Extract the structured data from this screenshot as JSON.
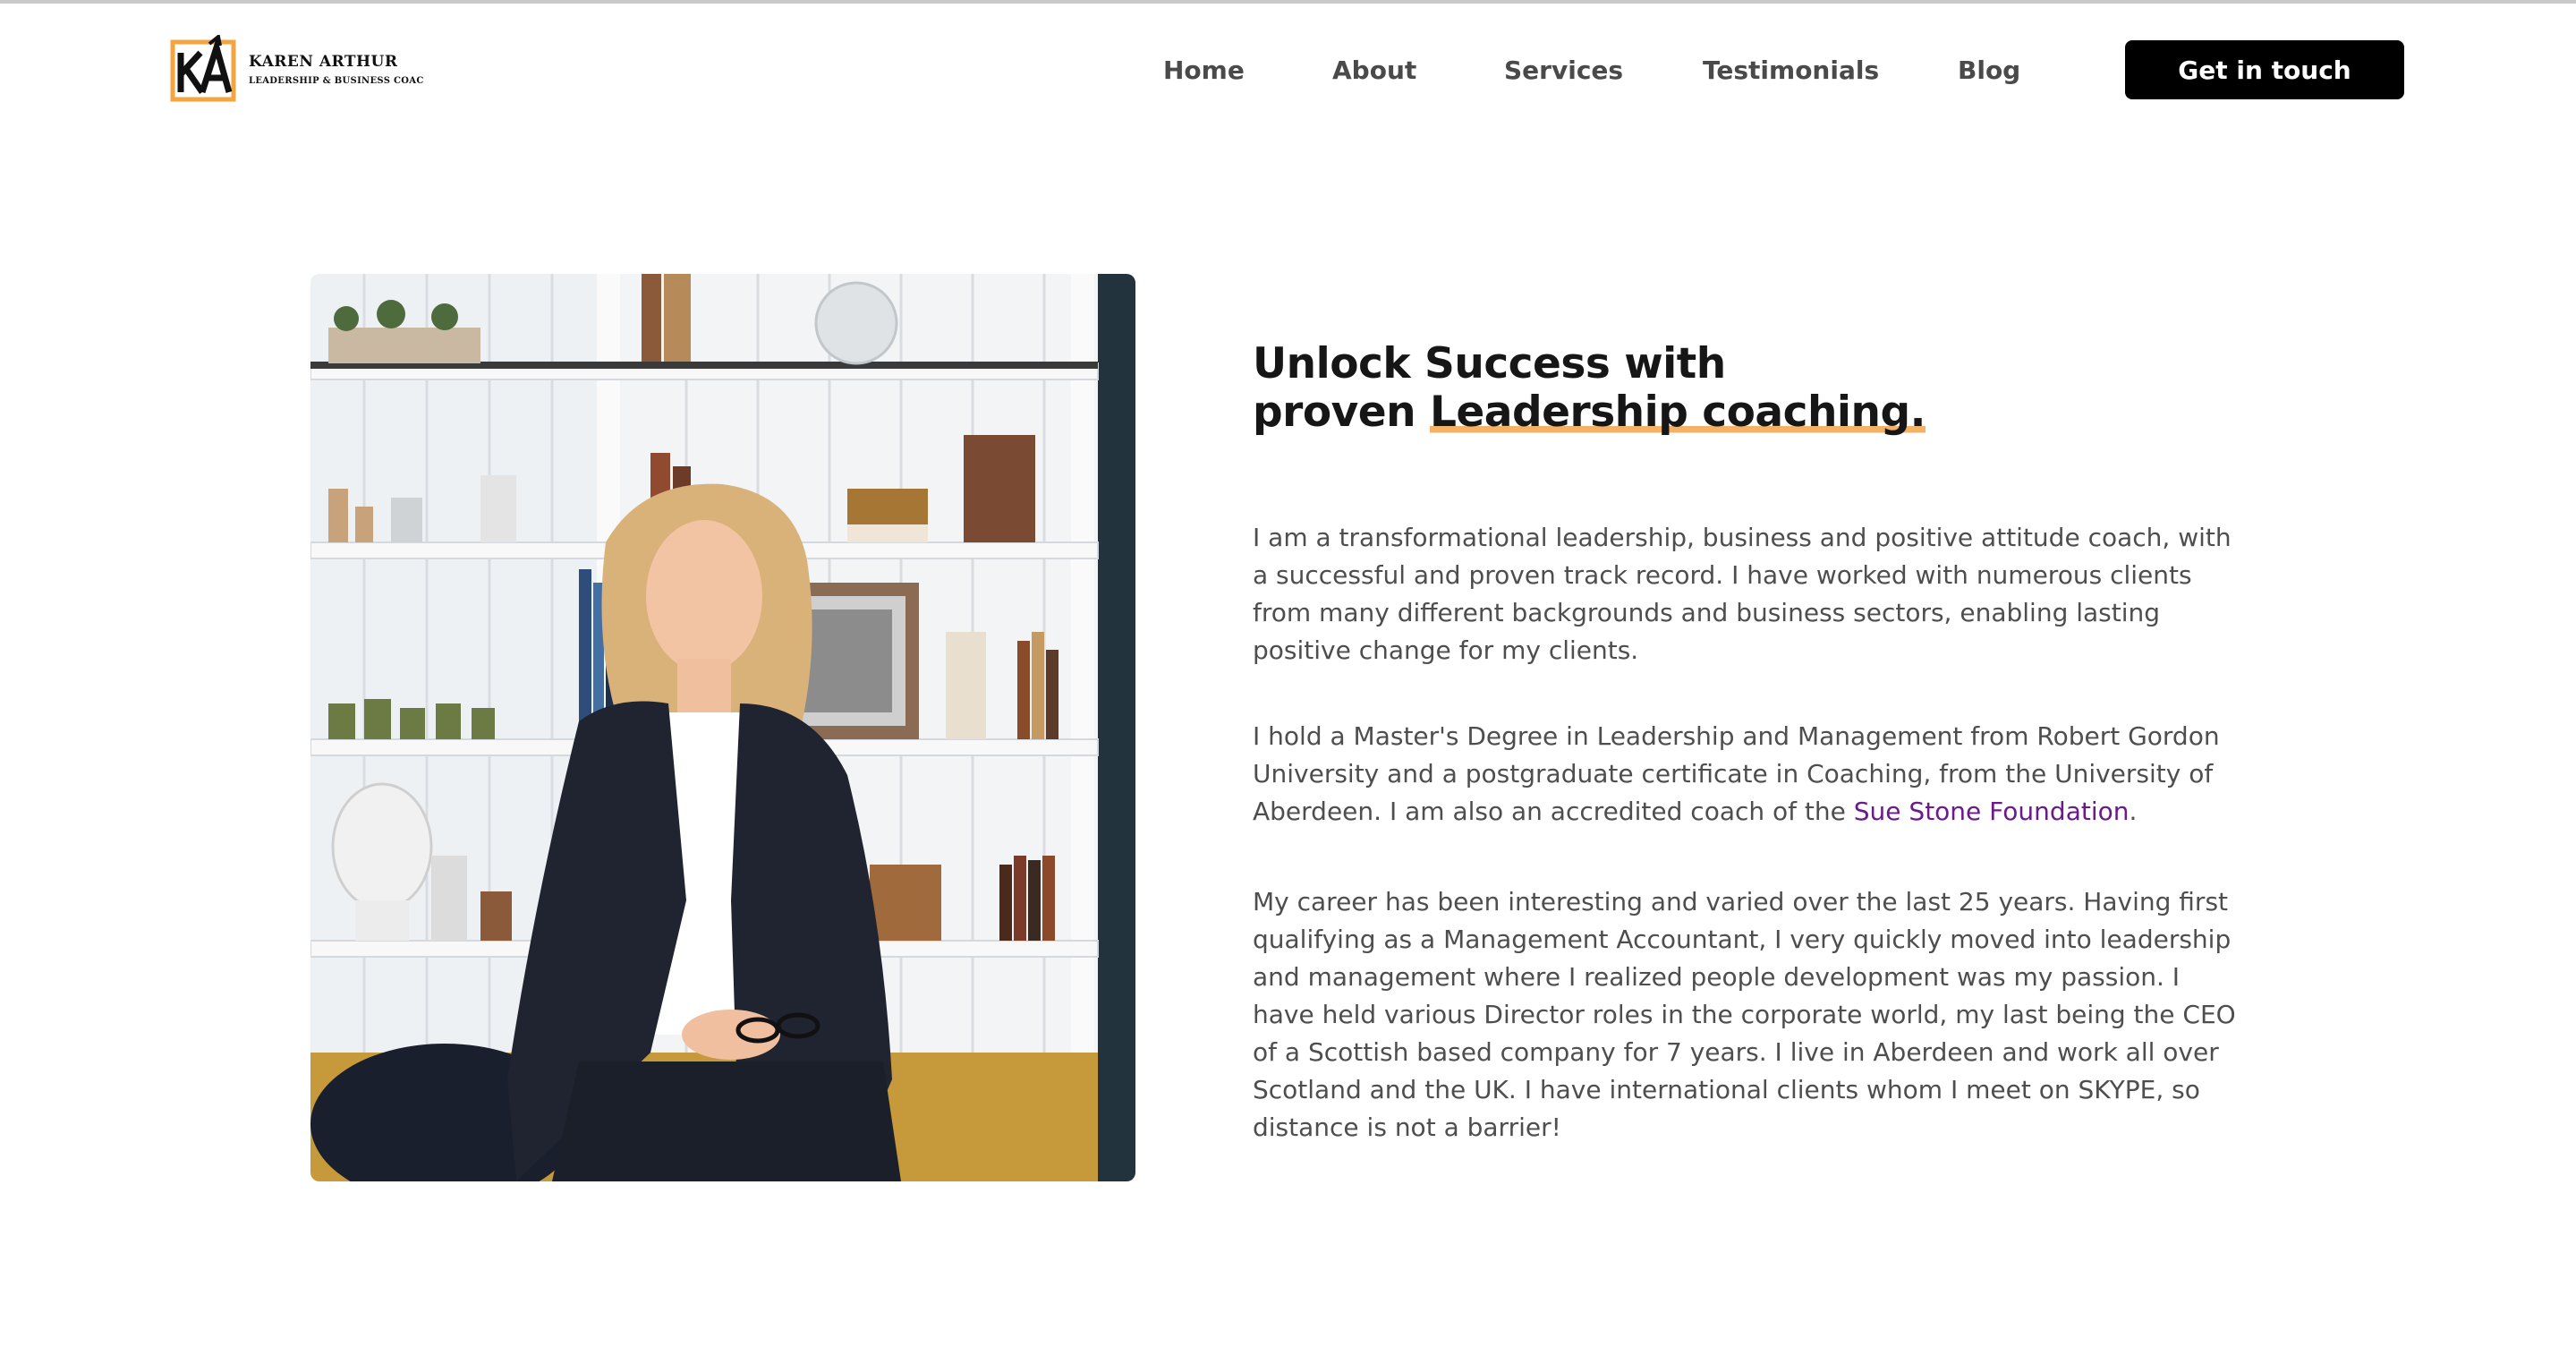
{
  "header": {
    "logo": {
      "monogram": "KA",
      "name": "KAREN ARTHUR",
      "tagline": "LEADERSHIP & BUSINESS COAC"
    },
    "nav": [
      {
        "label": "Home"
      },
      {
        "label": "About"
      },
      {
        "label": "Services"
      },
      {
        "label": "Testimonials"
      },
      {
        "label": "Blog"
      }
    ],
    "cta_label": "Get in touch"
  },
  "hero": {
    "photo_alt": "Portrait of Karen Arthur seated in front of a white bookshelf",
    "headline": {
      "line1": "Unlock Success with",
      "line2_prefix": "proven ",
      "line2_highlight": "Leadership coaching."
    },
    "paragraphs": {
      "p1": "I am a transformational leadership, business and positive attitude coach, with a successful and proven track record. I have worked with numerous clients from many different backgrounds and business sectors, enabling lasting positive change for my clients.",
      "p2_before_link": "I hold a Master's Degree in Leadership and Management from Robert Gordon University and a postgraduate certificate in Coaching, from the University of Aberdeen. I am also an accredited coach of the ",
      "p2_link": "Sue Stone Foundation",
      "p2_after_link": ".",
      "p3": "My career has been interesting and varied over the last 25 years. Having first qualifying as a Management Accountant, I very quickly moved into leadership and management where I realized people development was my passion. I have held various Director roles in the corporate world, my last being the CEO of a Scottish based company for 7 years. I live in Aberdeen and work all over Scotland and the UK. I have international clients whom I meet on SKYPE, so distance is not a barrier!"
    }
  },
  "colors": {
    "accent_orange": "#f4b266",
    "link_purple": "#6b1a8c",
    "cta_bg": "#000000",
    "text": "#4e4e4e"
  }
}
